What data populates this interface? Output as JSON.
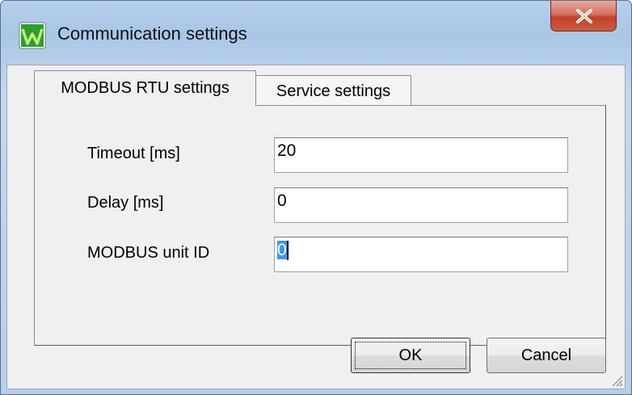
{
  "window": {
    "title": "Communication settings",
    "app_icon": "w-logo-icon",
    "close_icon": "close-icon"
  },
  "tabs": [
    {
      "label": "MODBUS RTU settings",
      "active": true
    },
    {
      "label": "Service settings",
      "active": false
    }
  ],
  "fields": {
    "timeout": {
      "label": "Timeout [ms]",
      "value": "20"
    },
    "delay": {
      "label": "Delay [ms]",
      "value": "0"
    },
    "unit_id": {
      "label": "MODBUS unit ID",
      "value": "0"
    }
  },
  "buttons": {
    "ok": "OK",
    "cancel": "Cancel"
  },
  "colors": {
    "close_button": "#c2402c",
    "selection": "#3399ff",
    "icon_green": "#2e9e2e"
  }
}
